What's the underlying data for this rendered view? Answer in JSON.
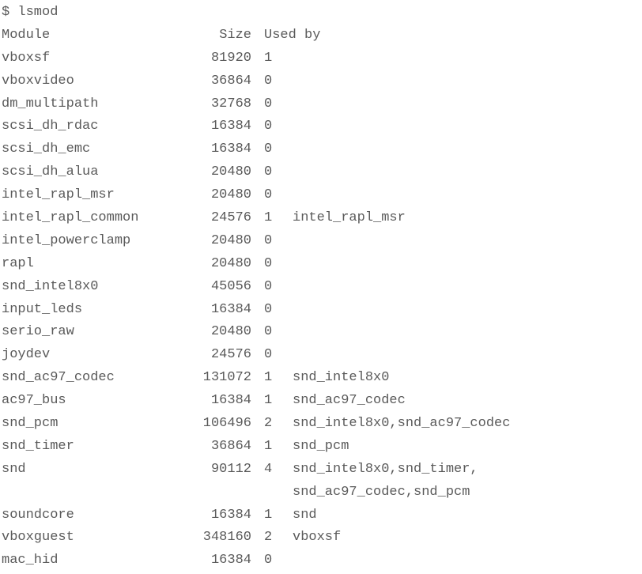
{
  "command": "$ lsmod",
  "header": {
    "module": "Module",
    "size": "Size",
    "usedby": "Used by"
  },
  "chart_data": {
    "type": "table",
    "columns": [
      "Module",
      "Size",
      "Used",
      "By"
    ],
    "rows": [
      {
        "module": "vboxsf",
        "size": 81920,
        "used": 1,
        "by": ""
      },
      {
        "module": "vboxvideo",
        "size": 36864,
        "used": 0,
        "by": ""
      },
      {
        "module": "dm_multipath",
        "size": 32768,
        "used": 0,
        "by": ""
      },
      {
        "module": "scsi_dh_rdac",
        "size": 16384,
        "used": 0,
        "by": ""
      },
      {
        "module": "scsi_dh_emc",
        "size": 16384,
        "used": 0,
        "by": ""
      },
      {
        "module": "scsi_dh_alua",
        "size": 20480,
        "used": 0,
        "by": ""
      },
      {
        "module": "intel_rapl_msr",
        "size": 20480,
        "used": 0,
        "by": ""
      },
      {
        "module": "intel_rapl_common",
        "size": 24576,
        "used": 1,
        "by": "intel_rapl_msr"
      },
      {
        "module": "intel_powerclamp",
        "size": 20480,
        "used": 0,
        "by": ""
      },
      {
        "module": "rapl",
        "size": 20480,
        "used": 0,
        "by": ""
      },
      {
        "module": "snd_intel8x0",
        "size": 45056,
        "used": 0,
        "by": ""
      },
      {
        "module": "input_leds",
        "size": 16384,
        "used": 0,
        "by": ""
      },
      {
        "module": "serio_raw",
        "size": 20480,
        "used": 0,
        "by": ""
      },
      {
        "module": "joydev",
        "size": 24576,
        "used": 0,
        "by": ""
      },
      {
        "module": "snd_ac97_codec",
        "size": 131072,
        "used": 1,
        "by": "snd_intel8x0"
      },
      {
        "module": "ac97_bus",
        "size": 16384,
        "used": 1,
        "by": "snd_ac97_codec"
      },
      {
        "module": "snd_pcm",
        "size": 106496,
        "used": 2,
        "by": "snd_intel8x0,snd_ac97_codec"
      },
      {
        "module": "snd_timer",
        "size": 36864,
        "used": 1,
        "by": "snd_pcm"
      },
      {
        "module": "snd",
        "size": 90112,
        "used": 4,
        "by": "snd_intel8x0,snd_timer,",
        "by2": "snd_ac97_codec,snd_pcm"
      },
      {
        "module": "soundcore",
        "size": 16384,
        "used": 1,
        "by": "snd"
      },
      {
        "module": "vboxguest",
        "size": 348160,
        "used": 2,
        "by": "vboxsf"
      },
      {
        "module": "mac_hid",
        "size": 16384,
        "used": 0,
        "by": ""
      }
    ]
  }
}
